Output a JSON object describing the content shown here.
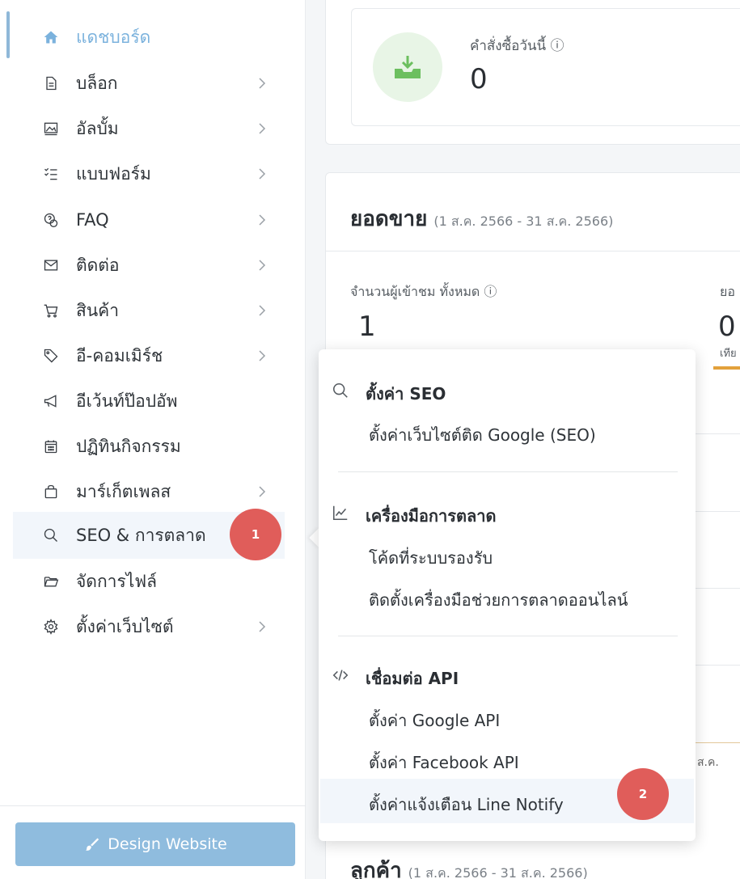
{
  "sidebar": {
    "items": [
      {
        "label": "แดชบอร์ด",
        "icon": "home-icon",
        "has_submenu": false
      },
      {
        "label": "บล็อก",
        "icon": "document-icon",
        "has_submenu": true
      },
      {
        "label": "อัลบั้ม",
        "icon": "image-icon",
        "has_submenu": true
      },
      {
        "label": "แบบฟอร์ม",
        "icon": "checklist-icon",
        "has_submenu": true
      },
      {
        "label": "FAQ",
        "icon": "faq-icon",
        "has_submenu": true
      },
      {
        "label": "ติดต่อ",
        "icon": "envelope-icon",
        "has_submenu": true
      },
      {
        "label": "สินค้า",
        "icon": "cart-icon",
        "has_submenu": true
      },
      {
        "label": "อี-คอมเมิร์ช",
        "icon": "tag-icon",
        "has_submenu": true
      },
      {
        "label": "อีเว้นท์ป๊อปอัพ",
        "icon": "megaphone-icon",
        "has_submenu": false
      },
      {
        "label": "ปฏิทินกิจกรรม",
        "icon": "calendar-icon",
        "has_submenu": false
      },
      {
        "label": "มาร์เก็ตเพลส",
        "icon": "shopping-bag-icon",
        "has_submenu": true
      },
      {
        "label": "SEO & การตลาด",
        "icon": "search-icon",
        "has_submenu": false
      },
      {
        "label": "จัดการไฟล์",
        "icon": "folder-icon",
        "has_submenu": false
      },
      {
        "label": "ตั้งค่าเว็บไซต์",
        "icon": "gear-icon",
        "has_submenu": true
      }
    ],
    "design_button": "Design Website"
  },
  "badges": {
    "first": "1",
    "second": "2"
  },
  "dashboard": {
    "orders_today_label": "คำสั่งซื้อวันนี้ ⓘ",
    "orders_today_value": "0",
    "sales_title": "ยอดขาย",
    "sales_range": "(1 ส.ค. 2566 - 31 ส.ค. 2566)",
    "visitors_label": "จำนวนผู้เข้าชม ทั้งหมด ⓘ",
    "visitors_value": "1",
    "right_label_stub": "ยอ",
    "right_value_stub": "0",
    "right_sub_stub": "เทีย",
    "month_stub": "ส.ค.",
    "customers_title": "ลูกค้า",
    "customers_range": "(1 ส.ค. 2566 - 31 ส.ค. 2566)"
  },
  "popover": {
    "sections": [
      {
        "heading": "ตั้งค่า SEO",
        "icon": "search-icon",
        "links": [
          "ตั้งค่าเว็บไซต์ติด Google (SEO)"
        ]
      },
      {
        "heading": "เครื่องมือการตลาด",
        "icon": "chart-line-icon",
        "links": [
          "โค้ดที่ระบบรองรับ",
          "ติดตั้งเครื่องมือช่วยการตลาดออนไลน์"
        ]
      },
      {
        "heading": "เชื่อมต่อ API",
        "icon": "code-icon",
        "links": [
          "ตั้งค่า Google API",
          "ตั้งค่า Facebook API",
          "ตั้งค่าแจ้งเตือน Line Notify"
        ]
      }
    ]
  },
  "colors": {
    "accent": "#7bb2dd",
    "badge": "#e05d5a",
    "design_button": "#8fbcde",
    "orders_icon_bg": "#e8f5e6",
    "orders_icon": "#6cbf5f",
    "sales_bar": "#e3a13b"
  }
}
